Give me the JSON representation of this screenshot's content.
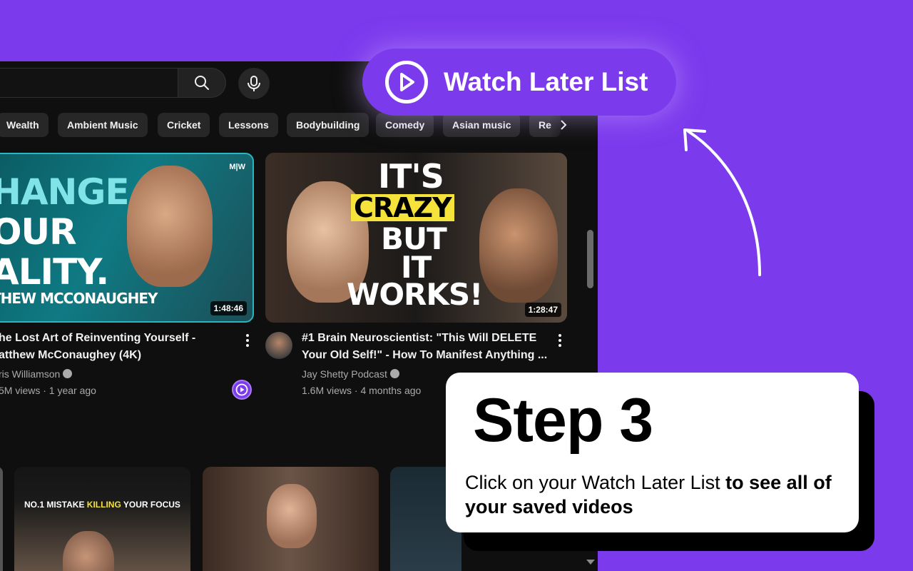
{
  "chips": [
    "Wealth",
    "Ambient Music",
    "Cricket",
    "Lessons",
    "Bodybuilding",
    "Comedy",
    "Asian music",
    "Re"
  ],
  "videos": [
    {
      "thumb_lines": [
        "HANGE",
        "OUR",
        "ALITY.",
        "THEW MCCONAUGHEY"
      ],
      "thumb_brand": "M|W",
      "duration": "1:48:46",
      "title_line1": "he Lost Art of Reinventing Yourself -",
      "title_line2": "atthew McConaughey (4K)",
      "channel": "ris Williamson",
      "stats": "5M views · 1 year ago"
    },
    {
      "thumb_lines": [
        "IT'S",
        "CRAZY",
        "BUT",
        "IT",
        "WORKS!"
      ],
      "duration": "1:28:47",
      "title_line1": "#1 Brain Neuroscientist: \"This Will DELETE",
      "title_line2": "Your Old Self!\" - How To Manifest Anything ...",
      "channel": "Jay Shetty Podcast",
      "stats": "1.6M views · 4 months ago"
    }
  ],
  "bottom_thumb": {
    "text_pre": "NO.1 MISTAKE ",
    "text_highlight": "KILLING",
    "text_post": " YOUR FOCUS"
  },
  "watch_later": {
    "label": "Watch Later List"
  },
  "step": {
    "title": "Step 3",
    "desc_normal": "Click on your Watch Later List",
    "desc_bold": " to see all of your saved videos"
  },
  "colors": {
    "background": "#7c3aed",
    "panel": "#0f0f0f",
    "chip": "#272727",
    "accent_teal": "#2bb5c0"
  }
}
